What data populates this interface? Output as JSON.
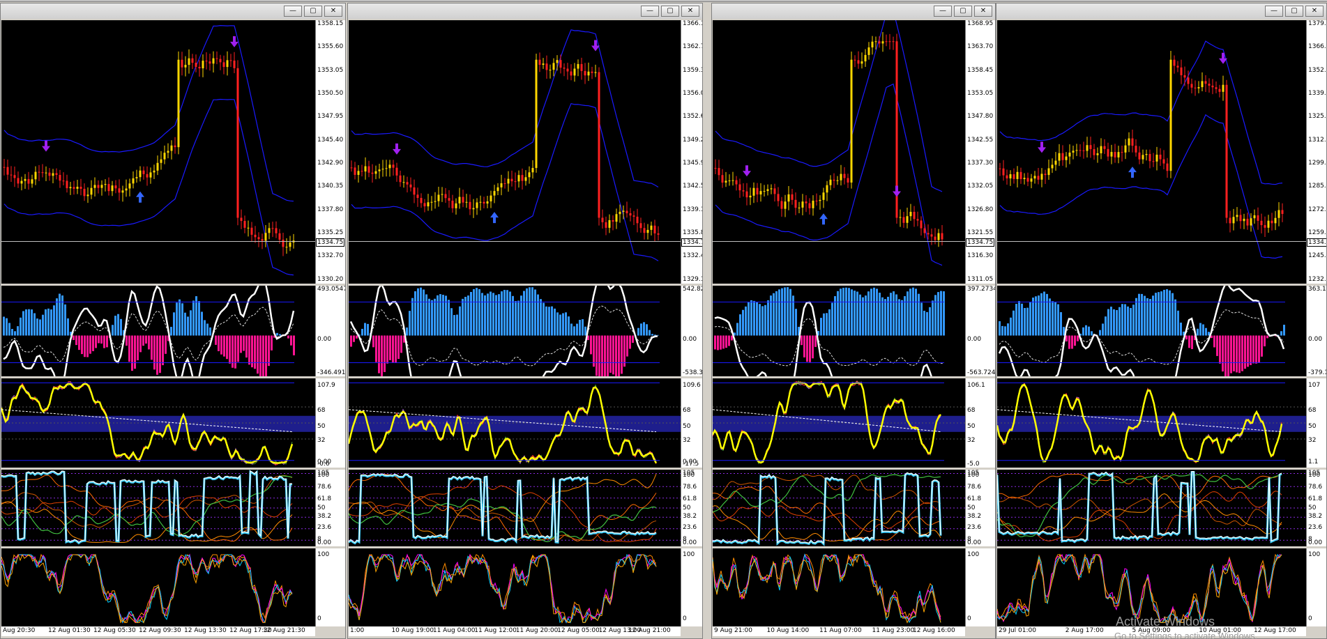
{
  "window_controls": {
    "minimize": "—",
    "restore": "▢",
    "close": "✕"
  },
  "colors": {
    "background": "#000000",
    "candle_bull": "#ffd700",
    "candle_bear": "#ff2020",
    "band": "#1a1aff",
    "hist_pos": "#3399ff",
    "hist_neg": "#ff1493",
    "signal_down": "#a020f0",
    "signal_up": "#3366ff",
    "rsi_zone": "#1e1e8c",
    "stoch_line": "#40d0ff"
  },
  "charts": [
    {
      "price_ticks": [
        "1358.15",
        "1355.60",
        "1353.05",
        "1350.50",
        "1347.95",
        "1345.40",
        "1342.90",
        "1340.35",
        "1337.80",
        "1335.25",
        "1332.70",
        "1330.20"
      ],
      "current_price": "1334.75",
      "macd_ticks": [
        "493.0547",
        "0.00",
        "-346.491"
      ],
      "rsi_ticks": [
        "107.9",
        "68",
        "50",
        "32",
        "0.00"
      ],
      "rsi_extra": "-0.6",
      "stoch_ticks": [
        "105",
        "100",
        "78.6",
        "61.8",
        "50",
        "38.2",
        "23.6",
        "8",
        "0.00"
      ],
      "osc_ticks": [
        "100",
        "0"
      ],
      "time_labels": [
        "Aug 20:30",
        "12 Aug 01:30",
        "12 Aug 05:30",
        "12 Aug 09:30",
        "12 Aug 13:30",
        "12 Aug 17:30",
        "12 Aug 21:30"
      ]
    },
    {
      "price_ticks": [
        "1366.10",
        "1362.70",
        "1359.30",
        "1356.00",
        "1352.60",
        "1349.20",
        "1345.90",
        "1342.50",
        "1339.10",
        "1335.80",
        "1332.40",
        "1329.10"
      ],
      "current_price": "1334.75",
      "macd_ticks": [
        "542.8255",
        "0.00",
        "-538.316"
      ],
      "rsi_ticks": [
        "109.6",
        "68",
        "50",
        "32",
        "0.00",
        "-17.5"
      ],
      "rsi_extra": "",
      "stoch_ticks": [
        "105",
        "100",
        "78.6",
        "61.8",
        "50",
        "38.2",
        "23.6",
        "8",
        "0.00"
      ],
      "osc_ticks": [
        "100",
        "0"
      ],
      "time_labels": [
        "1:00",
        "10 Aug 19:00",
        "11 Aug 04:00",
        "11 Aug 12:00",
        "11 Aug 20:00",
        "12 Aug 05:00",
        "12 Aug 13:00",
        "12 Aug 21:00"
      ]
    },
    {
      "price_ticks": [
        "1368.95",
        "1363.70",
        "1358.45",
        "1353.05",
        "1347.80",
        "1342.55",
        "1337.30",
        "1332.05",
        "1326.80",
        "1321.55",
        "1316.30",
        "1311.05"
      ],
      "current_price": "1334.75",
      "macd_ticks": [
        "397.2734",
        "0.00",
        "-563.724"
      ],
      "rsi_ticks": [
        "106.1",
        "68",
        "50",
        "32"
      ],
      "rsi_extra": "-5.0",
      "stoch_ticks": [
        "105",
        "100",
        "78.6",
        "61.8",
        "50",
        "38.2",
        "23.6",
        "8",
        "0.00"
      ],
      "osc_ticks": [
        "100",
        "0"
      ],
      "time_labels": [
        "9 Aug 21:00",
        "10 Aug 14:00",
        "11 Aug 07:00",
        "11 Aug 23:00",
        "12 Aug 16:00"
      ]
    },
    {
      "price_ticks": [
        "1379.",
        "1366.",
        "1352.",
        "1339.",
        "1325.",
        "1312.",
        "1299.",
        "1285.",
        "1272.",
        "1259.",
        "1245.",
        "1232."
      ],
      "current_price": "1334.",
      "macd_ticks": [
        "363.13",
        "0.00",
        "-379.1"
      ],
      "rsi_ticks": [
        "107",
        "68",
        "50",
        "32",
        "1.1"
      ],
      "rsi_extra": "",
      "stoch_ticks": [
        "105",
        "100",
        "78.6",
        "61.8",
        "50",
        "38.2",
        "23.6",
        "8",
        "0.00"
      ],
      "osc_ticks": [
        "100",
        "0"
      ],
      "time_labels": [
        "29 Jul 01:00",
        "2 Aug 17:00",
        "5 Aug 09:00",
        "10 Aug 01:00",
        "12 Aug 17:00"
      ]
    }
  ],
  "watermark": {
    "line1": "Activate Windows",
    "line2": "Go to Settings to activate Windows."
  }
}
